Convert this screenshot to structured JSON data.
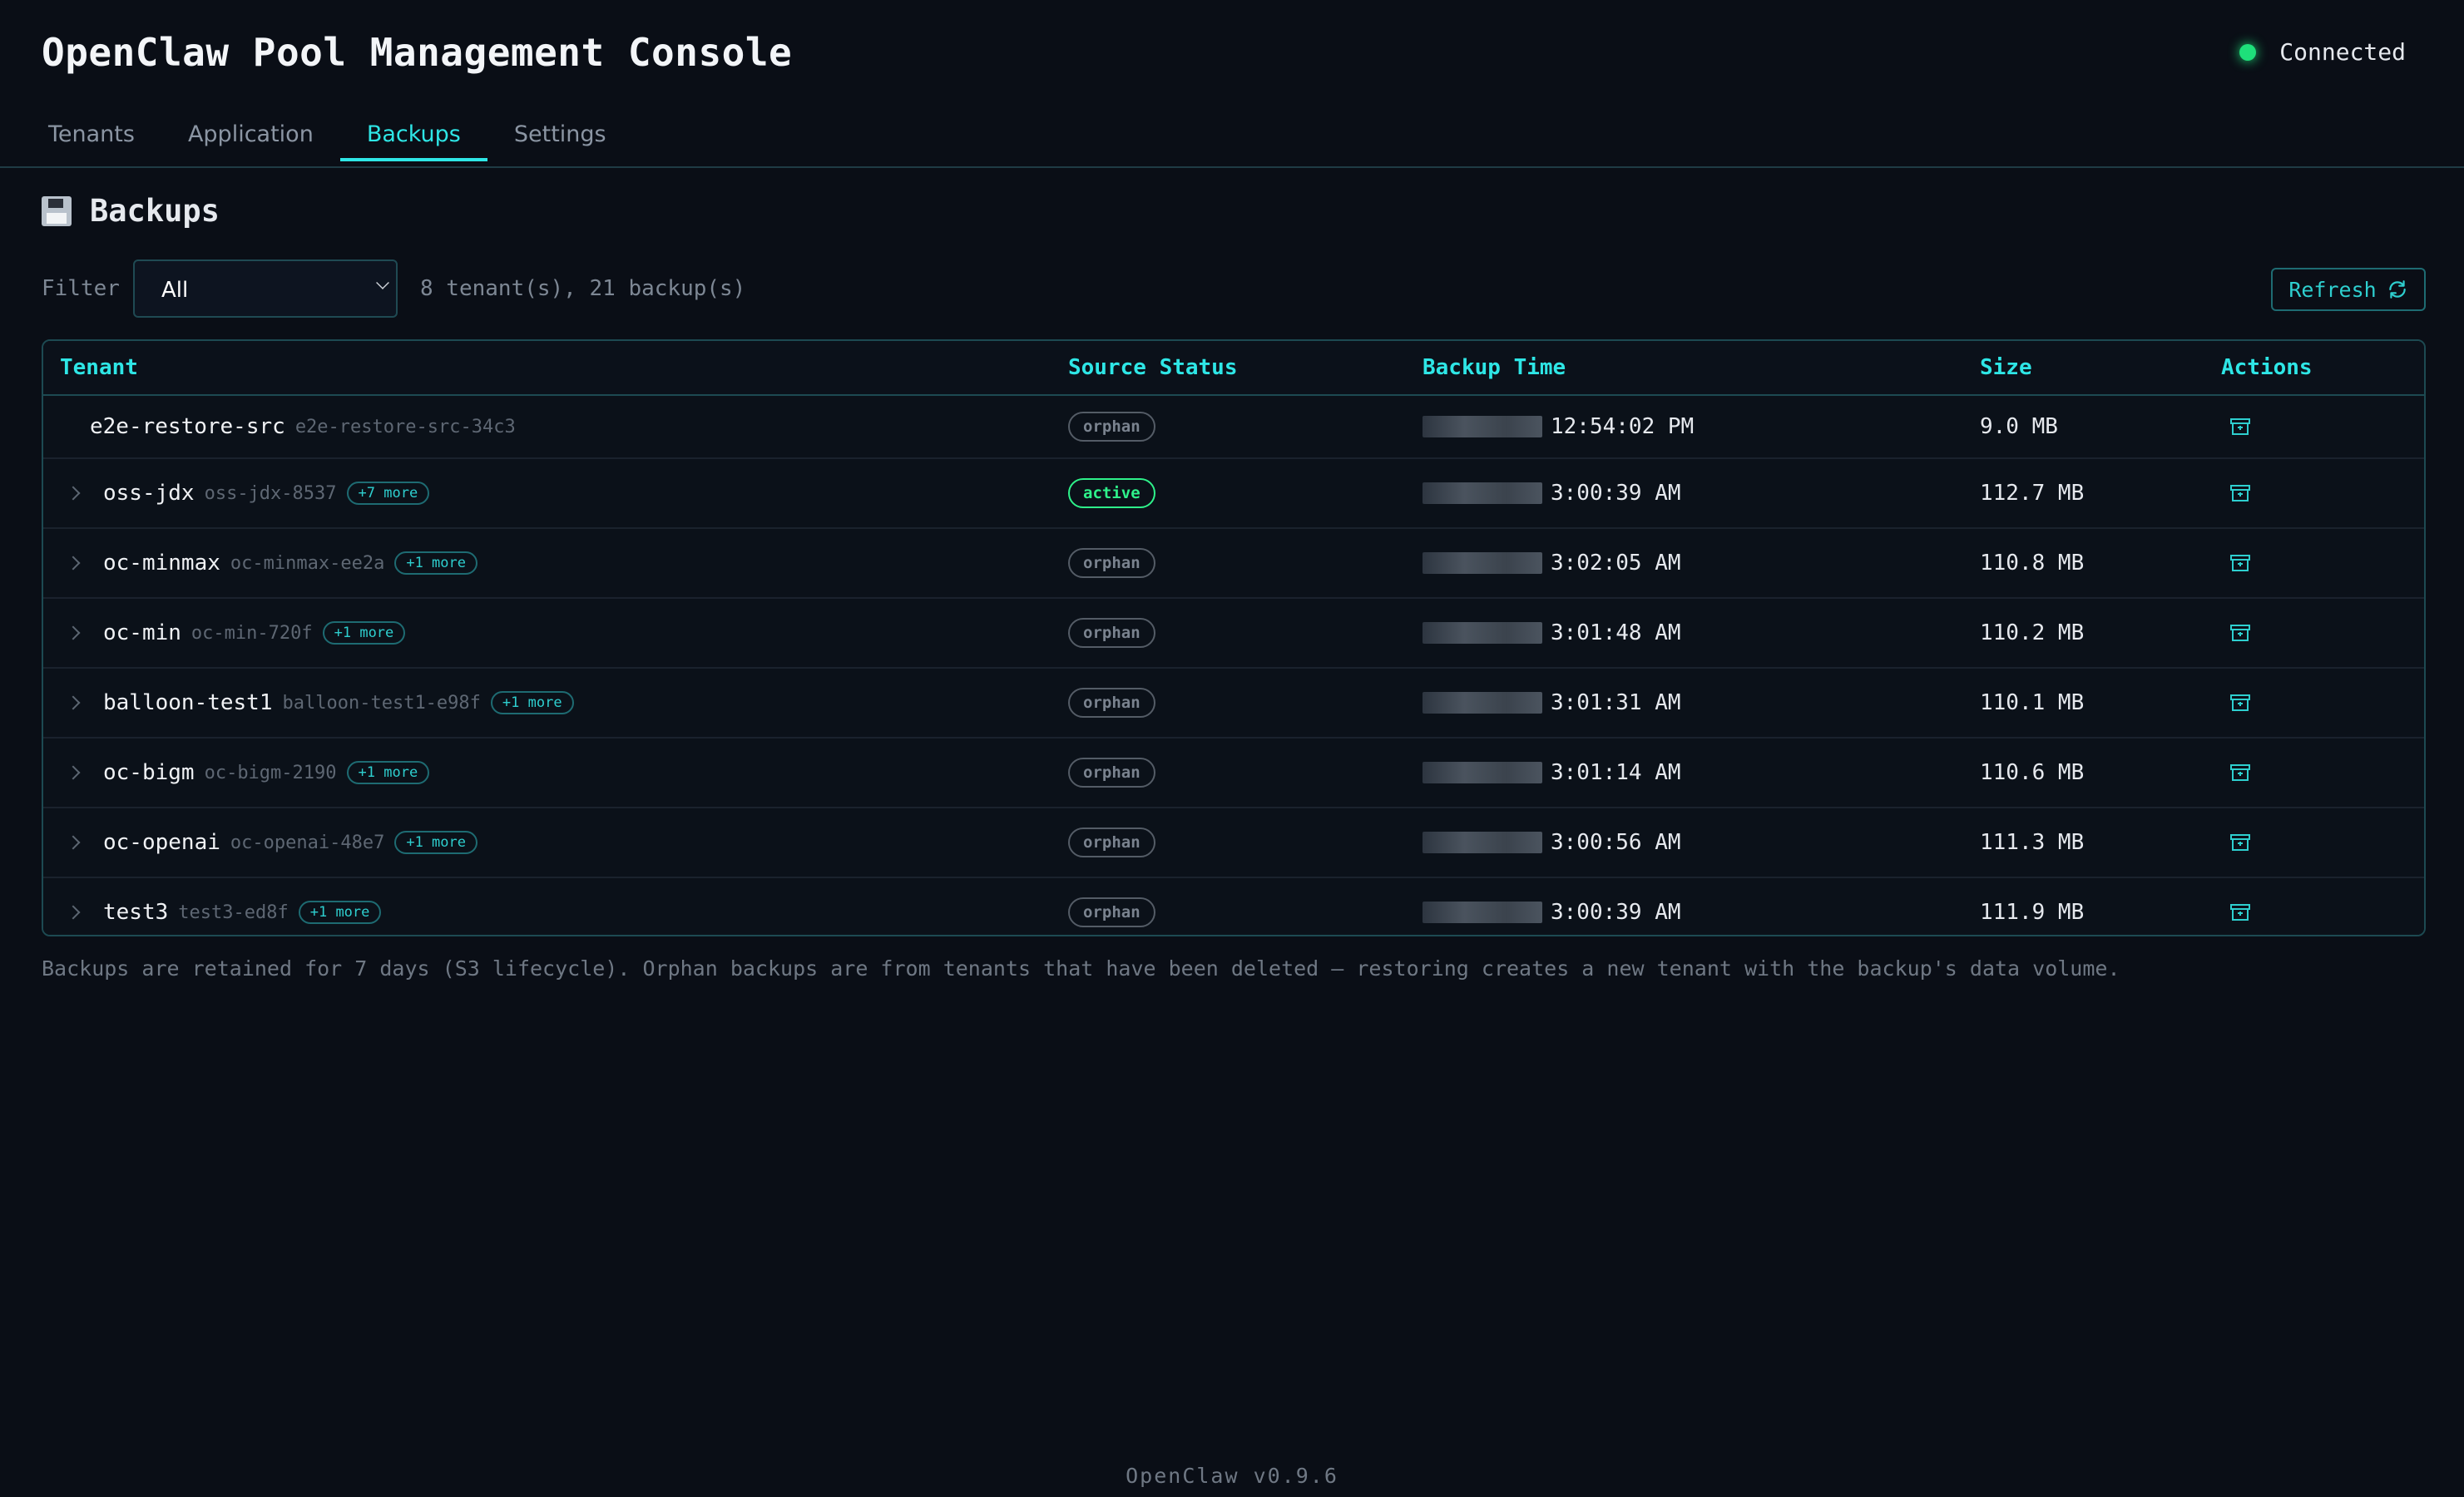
{
  "app": {
    "title": "OpenClaw Pool Management Console",
    "connection_status": "Connected",
    "connection_color": "#1ee07a"
  },
  "tabs": [
    {
      "label": "Tenants",
      "active": false
    },
    {
      "label": "Application",
      "active": false
    },
    {
      "label": "Backups",
      "active": true
    },
    {
      "label": "Settings",
      "active": false
    }
  ],
  "section": {
    "title": "Backups",
    "icon": "floppy-disk-icon"
  },
  "filter": {
    "label": "Filter",
    "selected": "All",
    "summary": "8 tenant(s), 21 backup(s)",
    "refresh_label": "Refresh",
    "refresh_icon": "refresh-icon"
  },
  "table": {
    "columns": {
      "tenant": "Tenant",
      "source_status": "Source Status",
      "backup_time": "Backup Time",
      "size": "Size",
      "actions": "Actions"
    },
    "rows": [
      {
        "name": "e2e-restore-src",
        "id": "e2e-restore-src-34c3",
        "more": "",
        "status": "orphan",
        "time": "12:54:02 PM",
        "size": "9.0 MB",
        "action_icon": "restore-archive-icon"
      },
      {
        "name": "oss-jdx",
        "id": "oss-jdx-8537",
        "more": "+7 more",
        "status": "active",
        "time": "3:00:39 AM",
        "size": "112.7 MB",
        "action_icon": "restore-archive-icon"
      },
      {
        "name": "oc-minmax",
        "id": "oc-minmax-ee2a",
        "more": "+1 more",
        "status": "orphan",
        "time": "3:02:05 AM",
        "size": "110.8 MB",
        "action_icon": "restore-archive-icon"
      },
      {
        "name": "oc-min",
        "id": "oc-min-720f",
        "more": "+1 more",
        "status": "orphan",
        "time": "3:01:48 AM",
        "size": "110.2 MB",
        "action_icon": "restore-archive-icon"
      },
      {
        "name": "balloon-test1",
        "id": "balloon-test1-e98f",
        "more": "+1 more",
        "status": "orphan",
        "time": "3:01:31 AM",
        "size": "110.1 MB",
        "action_icon": "restore-archive-icon"
      },
      {
        "name": "oc-bigm",
        "id": "oc-bigm-2190",
        "more": "+1 more",
        "status": "orphan",
        "time": "3:01:14 AM",
        "size": "110.6 MB",
        "action_icon": "restore-archive-icon"
      },
      {
        "name": "oc-openai",
        "id": "oc-openai-48e7",
        "more": "+1 more",
        "status": "orphan",
        "time": "3:00:56 AM",
        "size": "111.3 MB",
        "action_icon": "restore-archive-icon"
      },
      {
        "name": "test3",
        "id": "test3-ed8f",
        "more": "+1 more",
        "status": "orphan",
        "time": "3:00:39 AM",
        "size": "111.9 MB",
        "action_icon": "restore-archive-icon"
      }
    ]
  },
  "note": "Backups are retained for 7 days (S3 lifecycle). Orphan backups are from tenants that have been deleted — restoring creates a new tenant with the backup's data volume.",
  "footer": "OpenClaw v0.9.6",
  "colors": {
    "accent": "#2ee6e6",
    "background": "#0a0e16",
    "active_badge": "#2ef28a",
    "orphan_badge": "#7a838f"
  }
}
